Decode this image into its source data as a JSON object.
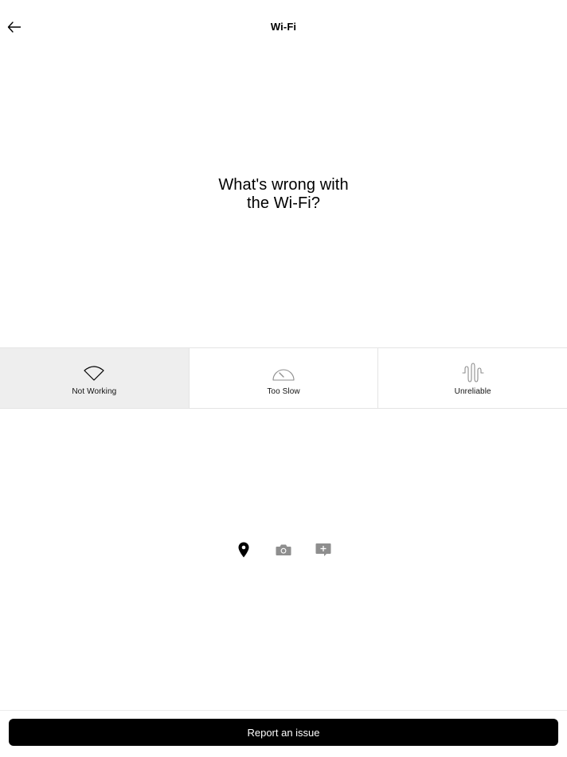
{
  "header": {
    "title": "Wi-Fi",
    "back_icon": "arrow-left-icon"
  },
  "question": {
    "line1": "What's wrong with",
    "line2": "the Wi-Fi?"
  },
  "options": [
    {
      "label": "Not Working",
      "icon": "wifi-icon",
      "selected": true
    },
    {
      "label": "Too Slow",
      "icon": "speedometer-icon",
      "selected": false
    },
    {
      "label": "Unreliable",
      "icon": "signal-wave-icon",
      "selected": false
    }
  ],
  "attachments": [
    {
      "icon": "location-pin-icon"
    },
    {
      "icon": "camera-icon"
    },
    {
      "icon": "add-comment-icon"
    }
  ],
  "footer": {
    "button_label": "Report an issue"
  },
  "colors": {
    "selected_bg": "#eeeeee",
    "divider": "#e4e4e4",
    "icon_inactive": "#8e8e8e",
    "button_bg": "#000000",
    "button_text": "#ffffff"
  }
}
